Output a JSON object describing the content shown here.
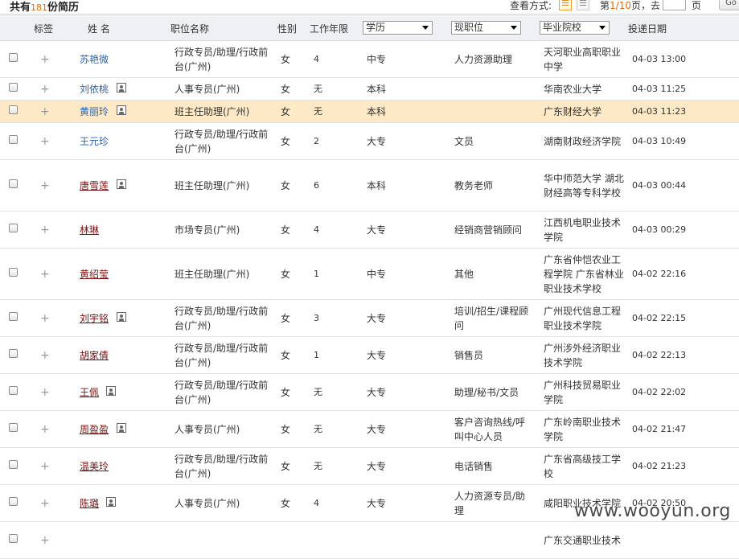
{
  "summary": {
    "prefix": "共有",
    "count": "181",
    "suffix": "份简历"
  },
  "view": {
    "label": "查看方式:"
  },
  "pager": {
    "prefix": "第",
    "current": "1",
    "sep": "/",
    "total": "10",
    "mid": "页，去",
    "suffix": "页",
    "go_label": "Go"
  },
  "headers": {
    "tag": "标签",
    "name": "姓 名",
    "position": "职位名称",
    "gender": "性别",
    "years": "工作年限",
    "education": "学历",
    "current_job": "现职位",
    "school": "毕业院校",
    "date": "投递日期"
  },
  "rows": [
    {
      "name": "苏艳微",
      "photo": false,
      "link": "blue",
      "position": "行政专员/助理/行政前台(广州)",
      "gender": "女",
      "years": "4",
      "edu": "中专",
      "job": "人力资源助理",
      "school": "天河职业高职职业中学",
      "date": "04-03 13:00"
    },
    {
      "name": "刘依桃",
      "photo": true,
      "link": "blue",
      "position": "人事专员(广州)",
      "gender": "女",
      "years": "无",
      "edu": "本科",
      "job": "",
      "school": "华南农业大学",
      "date": "04-03 11:25"
    },
    {
      "name": "黄丽玲",
      "photo": true,
      "link": "blue",
      "position": "班主任助理(广州)",
      "gender": "女",
      "years": "无",
      "edu": "本科",
      "job": "",
      "school": "广东财经大学",
      "date": "04-03 11:23"
    },
    {
      "name": "王元珍",
      "photo": false,
      "link": "blue",
      "position": "行政专员/助理/行政前台(广州)",
      "gender": "女",
      "years": "2",
      "edu": "大专",
      "job": "文员",
      "school": "湖南财政经济学院",
      "date": "04-03 10:49"
    },
    {
      "name": "唐雪莲",
      "photo": true,
      "link": "red",
      "position": "班主任助理(广州)",
      "gender": "女",
      "years": "6",
      "edu": "本科",
      "job": "教务老师",
      "school": "华中师范大学 湖北财经高等专科学校",
      "date": "04-03 00:44"
    },
    {
      "name": "林琳",
      "photo": false,
      "link": "red",
      "position": "市场专员(广州)",
      "gender": "女",
      "years": "4",
      "edu": "大专",
      "job": "经销商营销顾问",
      "school": "江西机电职业技术学院",
      "date": "04-03 00:29"
    },
    {
      "name": "黄绍莹",
      "photo": false,
      "link": "red",
      "position": "班主任助理(广州)",
      "gender": "女",
      "years": "1",
      "edu": "中专",
      "job": "其他",
      "school": "广东省仲恺农业工程学院 广东省林业职业技术学校",
      "date": "04-02 22:16"
    },
    {
      "name": "刘宇铭",
      "photo": true,
      "link": "red",
      "position": "行政专员/助理/行政前台(广州)",
      "gender": "女",
      "years": "3",
      "edu": "大专",
      "job": "培训/招生/课程顾问",
      "school": "广州现代信息工程职业技术学院",
      "date": "04-02 22:15"
    },
    {
      "name": "胡家倩",
      "photo": false,
      "link": "red",
      "position": "行政专员/助理/行政前台(广州)",
      "gender": "女",
      "years": "1",
      "edu": "大专",
      "job": "销售员",
      "school": "广州涉外经济职业技术学院",
      "date": "04-02 22:13"
    },
    {
      "name": "王佩",
      "photo": true,
      "link": "red",
      "position": "行政专员/助理/行政前台(广州)",
      "gender": "女",
      "years": "无",
      "edu": "大专",
      "job": "助理/秘书/文员",
      "school": "广州科技贸易职业学院",
      "date": "04-02 22:02"
    },
    {
      "name": "周盈盈",
      "photo": true,
      "link": "red",
      "position": "人事专员(广州)",
      "gender": "女",
      "years": "无",
      "edu": "大专",
      "job": "客户咨询热线/呼叫中心人员",
      "school": "广东岭南职业技术学院",
      "date": "04-02 21:47"
    },
    {
      "name": "温美玲",
      "photo": false,
      "link": "red",
      "position": "行政专员/助理/行政前台(广州)",
      "gender": "女",
      "years": "无",
      "edu": "大专",
      "job": "电话销售",
      "school": "广东省高级技工学校",
      "date": "04-02 21:23"
    },
    {
      "name": "陈璐",
      "photo": true,
      "link": "red",
      "position": "人事专员(广州)",
      "gender": "女",
      "years": "4",
      "edu": "大专",
      "job": "人力资源专员/助理",
      "school": "咸阳职业技术学院",
      "date": "04-02 20:50"
    },
    {
      "name": "",
      "photo": false,
      "link": "red",
      "position": "",
      "gender": "",
      "years": "",
      "edu": "",
      "job": "",
      "school": "广东交通职业技术",
      "date": ""
    }
  ],
  "watermark": "www.wooyun.org"
}
